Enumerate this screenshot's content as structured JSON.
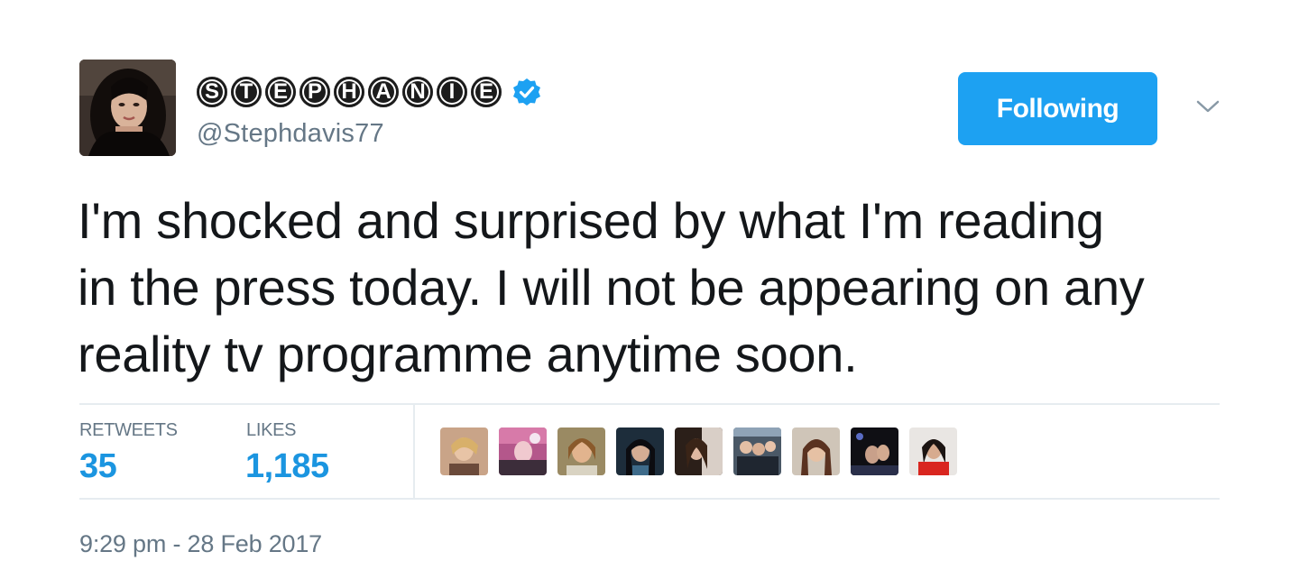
{
  "user": {
    "display_name_letters": [
      "S",
      "T",
      "E",
      "P",
      "H",
      "A",
      "N",
      "I",
      "E"
    ],
    "handle": "@Stephdavis77",
    "verified": true
  },
  "actions": {
    "follow_label": "Following",
    "caret_icon": "chevron-down-icon"
  },
  "tweet": {
    "lines": [
      "I'm shocked and surprised by what I'm reading",
      "in the press today. I will not be appearing on any",
      "reality tv programme anytime soon."
    ]
  },
  "stats": {
    "retweets_label": "RETWEETS",
    "retweets_value": "35",
    "likes_label": "LIKES",
    "likes_value": "1,185"
  },
  "timestamp": "9:29 pm - 28 Feb 2017",
  "colors": {
    "accent": "#1da1f2",
    "stat_value": "#1b95e0",
    "muted": "#657786"
  }
}
